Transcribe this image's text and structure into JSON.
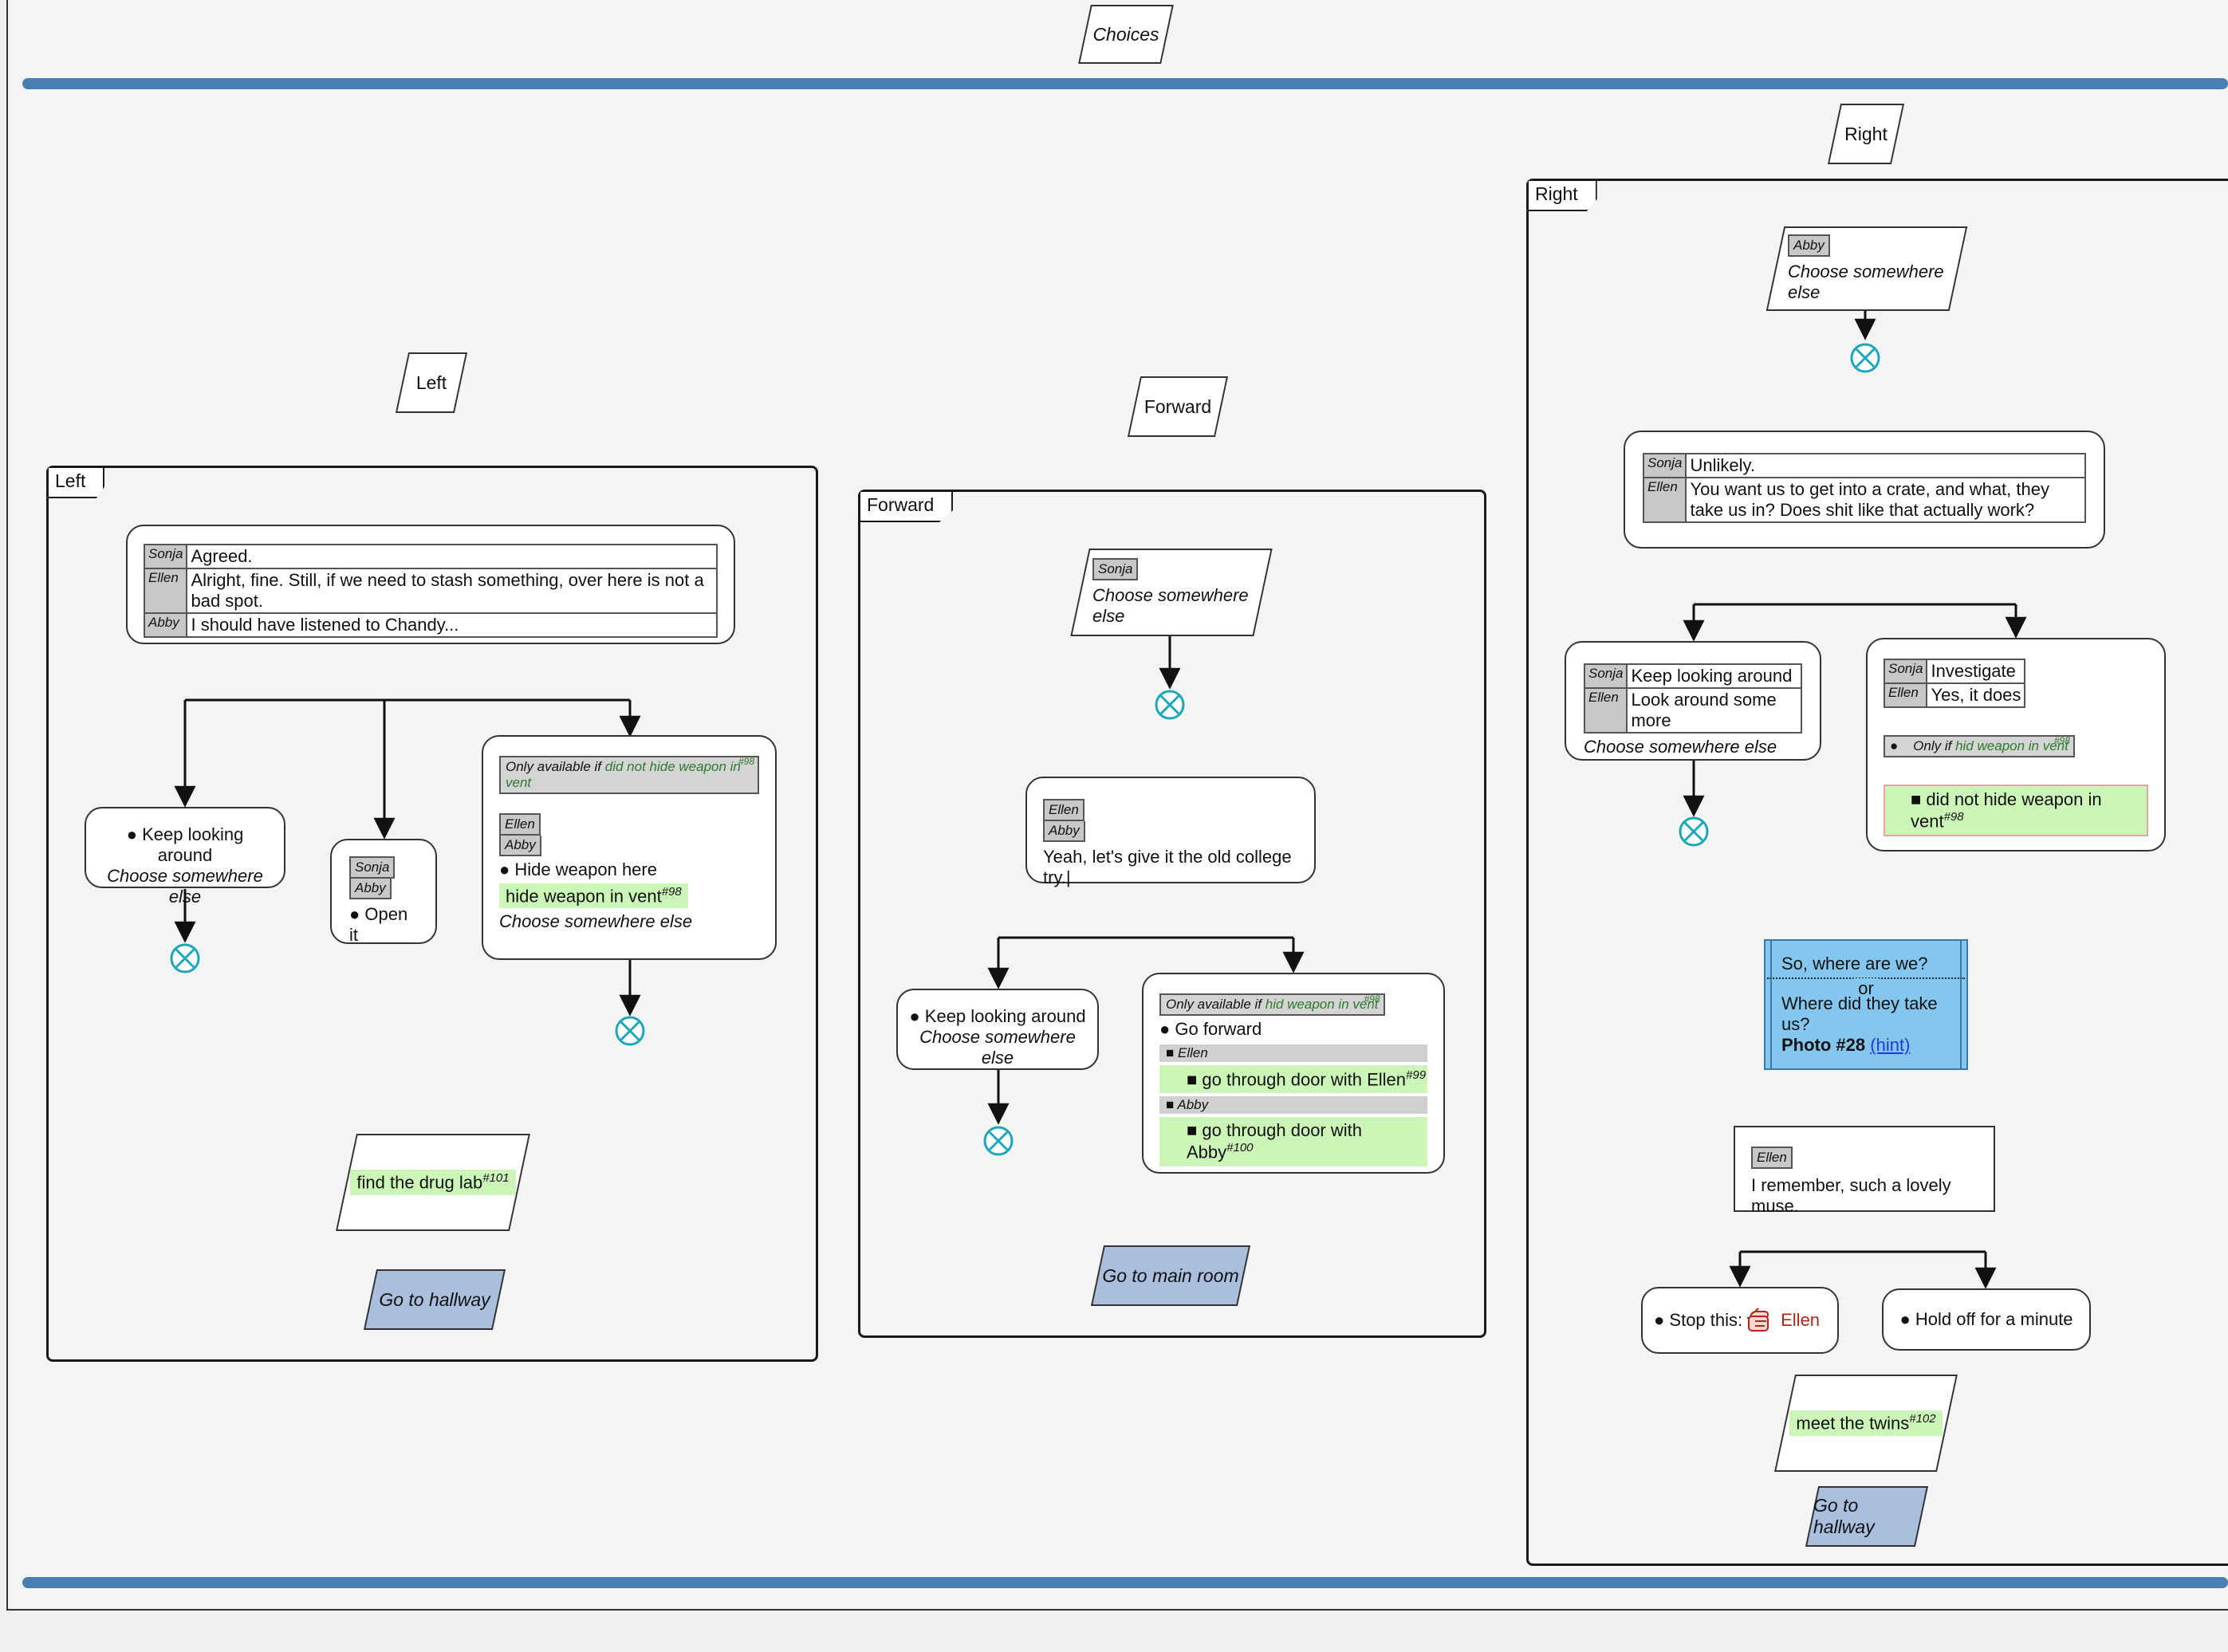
{
  "header": {
    "title": "Choices"
  },
  "colors": {
    "bar": "#4a7fb3",
    "green_highlight": "#ccf5b8",
    "jump_box": "#a9bfdd",
    "note_box": "#85c6ef",
    "end_marker": "#1da6b8",
    "link": "#1a39e0",
    "ellen_red": "#b3261e"
  },
  "left": {
    "label_top": "Left",
    "frame_label": "Left",
    "dialogue": [
      {
        "speaker": "Sonja",
        "line": "Agreed."
      },
      {
        "speaker": "Ellen",
        "line": "Alright, fine. Still, if we need to stash something, over here is not a bad spot."
      },
      {
        "speaker": "Abby",
        "line": "I should have listened to Chandy..."
      }
    ],
    "opt1": {
      "bullet": "Keep looking around",
      "sub": "Choose somewhere else"
    },
    "opt2": {
      "speakers": [
        "Sonja",
        "Abby"
      ],
      "bullet": "Open it"
    },
    "opt3": {
      "cond_prefix": "Only available if",
      "cond_value": "did not hide weapon in vent",
      "cond_num": "#98",
      "speakers": [
        "Ellen",
        "Abby"
      ],
      "bullet": "Hide weapon here",
      "flag": "hide weapon in vent",
      "flag_num": "#98",
      "sub": "Choose somewhere else"
    },
    "goal": {
      "text": "find the drug lab",
      "num": "#101"
    },
    "goto": "Go to hallway"
  },
  "forward": {
    "label_top": "Forward",
    "frame_label": "Forward",
    "start": {
      "speaker": "Sonja",
      "text": "Choose somewhere else"
    },
    "say": {
      "speakers": [
        "Ellen",
        "Abby"
      ],
      "line": "Yeah, let's give it the old college try.|"
    },
    "opt1": {
      "bullet": "Keep looking around",
      "sub": "Choose somewhere else"
    },
    "opt2": {
      "cond_prefix": "Only available if",
      "cond_value": "hid weapon in vent",
      "cond_num": "#98",
      "bullet": "Go forward",
      "branches": [
        {
          "who": "Ellen",
          "flag": "go through door with Ellen",
          "num": "#99"
        },
        {
          "who": "Abby",
          "flag": "go through door with Abby",
          "num": "#100"
        }
      ]
    },
    "goto": "Go to main room"
  },
  "right": {
    "label_top": "Right",
    "frame_label": "Right",
    "start": {
      "speaker": "Abby",
      "text": "Choose somewhere else"
    },
    "dialogue": [
      {
        "speaker": "Sonja",
        "line": "Unlikely."
      },
      {
        "speaker": "Ellen",
        "line": "You want us to get into a crate, and what, they take us in? Does shit like that actually work?"
      }
    ],
    "opt1": {
      "rows": [
        {
          "speaker": "Sonja",
          "line": "Keep looking around"
        },
        {
          "speaker": "Ellen",
          "line": "Look around some more"
        }
      ],
      "sub": "Choose somewhere else"
    },
    "opt2": {
      "rows": [
        {
          "speaker": "Sonja",
          "line": "Investigate"
        },
        {
          "speaker": "Ellen",
          "line": "Yes, it does"
        }
      ],
      "cond_prefix": "Only if",
      "cond_value": "hid weapon in vent",
      "cond_num": "#98",
      "flag": "did not hide weapon in vent",
      "flag_num": "#98"
    },
    "note": {
      "line1": "So, where are we?",
      "or": "or",
      "line2": "Where did they take us?",
      "photo": "Photo #28",
      "hint": "(hint)"
    },
    "say": {
      "speaker": "Ellen",
      "line": "I remember, such a lovely muse."
    },
    "choiceA": {
      "text": "Stop this:",
      "who": "Ellen"
    },
    "choiceB": {
      "text": "Hold off for a minute"
    },
    "goal": {
      "text": "meet the twins",
      "num": "#102"
    },
    "goto": "Go to hallway"
  }
}
